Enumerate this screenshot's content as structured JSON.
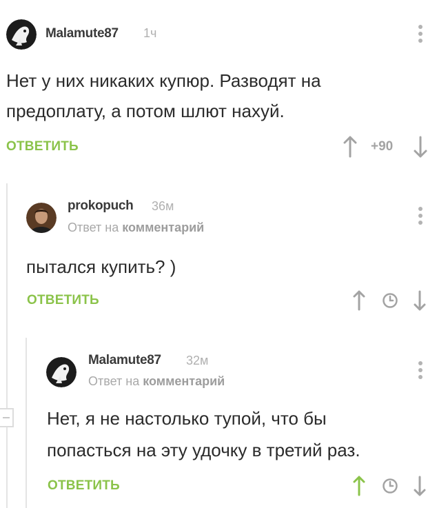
{
  "colors": {
    "accent_green": "#8bc34a",
    "muted": "#a8a8a8",
    "thread_line": "#e4e4e4"
  },
  "comments": [
    {
      "author": "Malamute87",
      "time": "1ч",
      "body_lines": [
        "Нет у них никаких купюр. Разводят на",
        "предоплату, а потом шлют нахуй."
      ],
      "reply_label": "ОТВЕТИТЬ",
      "score": "+90",
      "icons": [
        "avatar-image",
        "more-vert-icon",
        "arrow-up-icon",
        "arrow-down-icon"
      ]
    },
    {
      "author": "prokopuch",
      "time": "36м",
      "reply_prefix": "Ответ на",
      "reply_link": "комментарий",
      "body_lines": [
        "пытался купить? )"
      ],
      "reply_label": "ОТВЕТИТЬ",
      "icons": [
        "avatar-image",
        "more-vert-icon",
        "arrow-up-icon",
        "clock-icon",
        "arrow-down-icon"
      ]
    },
    {
      "author": "Malamute87",
      "time": "32м",
      "reply_prefix": "Ответ на",
      "reply_link": "комментарий",
      "body_lines": [
        "Нет, я не настолько тупой, что бы",
        "попасться на эту удочку в третий раз."
      ],
      "reply_label": "ОТВЕТИТЬ",
      "upvoted": true,
      "icons": [
        "avatar-image",
        "more-vert-icon",
        "arrow-up-icon",
        "clock-icon",
        "arrow-down-icon"
      ]
    }
  ]
}
